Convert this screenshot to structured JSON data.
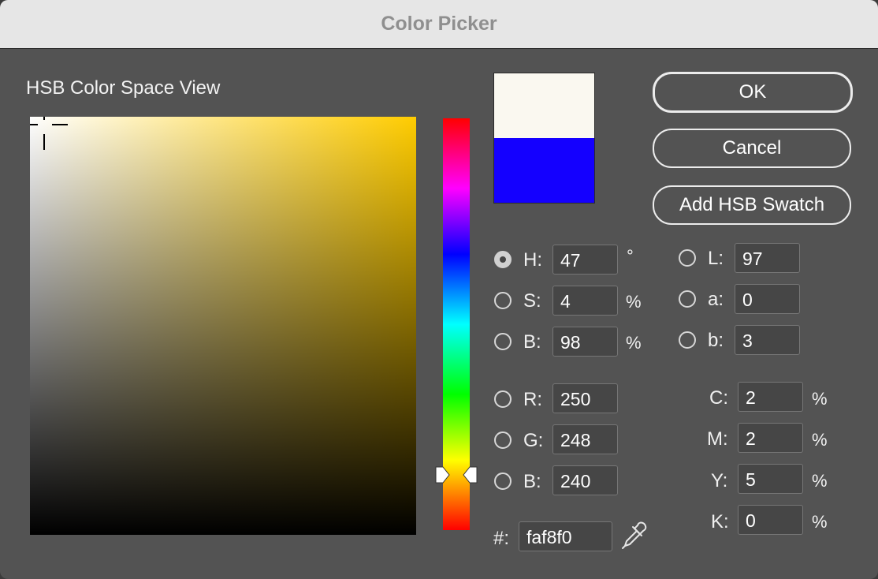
{
  "window": {
    "title": "Color Picker"
  },
  "color_field": {
    "label": "HSB Color Space View"
  },
  "colors": {
    "new": "#faf8f0",
    "original": "#1400ff"
  },
  "buttons": {
    "ok": "OK",
    "cancel": "Cancel",
    "add_swatch": "Add HSB Swatch"
  },
  "hsb": {
    "h": {
      "label": "H:",
      "value": "47",
      "unit": "°",
      "selected": true
    },
    "s": {
      "label": "S:",
      "value": "4",
      "unit": "%"
    },
    "b": {
      "label": "B:",
      "value": "98",
      "unit": "%"
    }
  },
  "rgb": {
    "r": {
      "label": "R:",
      "value": "250"
    },
    "g": {
      "label": "G:",
      "value": "248"
    },
    "b": {
      "label": "B:",
      "value": "240"
    }
  },
  "lab": {
    "l": {
      "label": "L:",
      "value": "97"
    },
    "a": {
      "label": "a:",
      "value": "0"
    },
    "b": {
      "label": "b:",
      "value": "3"
    }
  },
  "cmyk": {
    "c": {
      "label": "C:",
      "value": "2",
      "unit": "%"
    },
    "m": {
      "label": "M:",
      "value": "2",
      "unit": "%"
    },
    "y": {
      "label": "Y:",
      "value": "5",
      "unit": "%"
    },
    "k": {
      "label": "K:",
      "value": "0",
      "unit": "%"
    }
  },
  "hex": {
    "label": "#:",
    "value": "faf8f0"
  },
  "icons": {
    "eyedropper": "eyedropper-icon"
  }
}
